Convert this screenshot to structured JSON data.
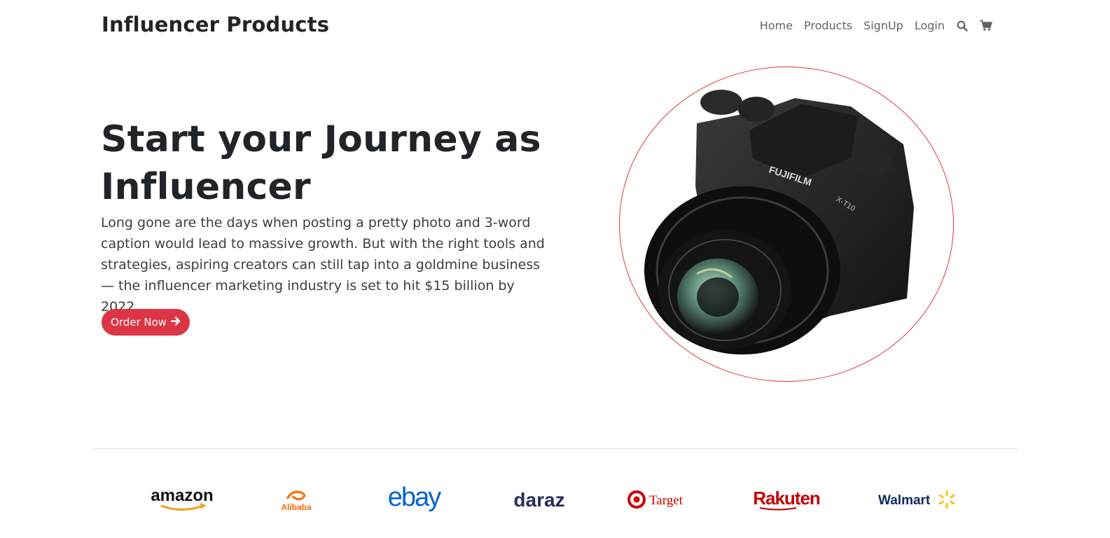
{
  "nav": {
    "brand": "Influencer Products",
    "links": [
      "Home",
      "Products",
      "SignUp",
      "Login"
    ],
    "icons": [
      "search-icon",
      "cart-icon"
    ]
  },
  "hero": {
    "title": "Start your Journey as Influencer",
    "description": "Long gone are the days when posting a pretty photo and 3-word caption would lead to massive growth. But with the right tools and strategies, aspiring creators can still tap into a goldmine business — the influencer marketing industry is set to hit $15 billion by 2022.",
    "button_label": "Order Now",
    "button_icon": "arrow-right-icon",
    "image_alt": "camera-image",
    "camera_brand": "FUJIFILM",
    "camera_model": "X-T10"
  },
  "partners": {
    "logos": [
      "amazon",
      "Alibaba",
      "ebay",
      "daraz",
      "Target",
      "Rakuten",
      "Walmart"
    ]
  },
  "colors": {
    "accent": "#dc3545",
    "text": "#212529",
    "nav_link": "#5f6368",
    "divider": "#dfe1e4"
  }
}
